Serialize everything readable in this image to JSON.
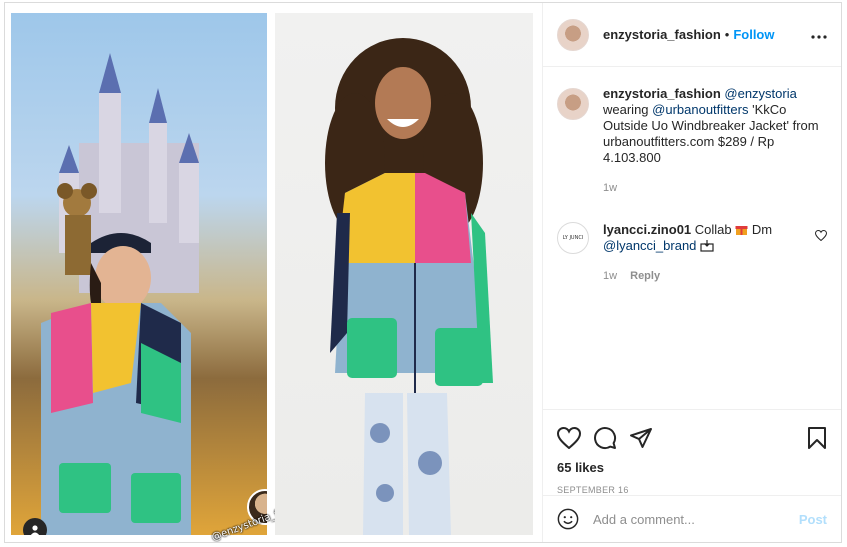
{
  "post": {
    "username": "enzystoria_fashion",
    "follow_label": "Follow",
    "more_label": "•••",
    "watermark": "@enzystoria_fashion"
  },
  "caption": {
    "username": "enzystoria_fashion",
    "mention_1": "@enzystoria",
    "text_1": "wearing",
    "mention_2": "@urbanoutfitters",
    "text_2": "'KkCo Outside Uo Windbreaker Jacket' from urbanoutfitters.com $289 / Rp 4.103.800",
    "time": "1w"
  },
  "comment": {
    "username": "lyancci.zino01",
    "text_1": "Collab",
    "text_2": "Dm",
    "mention": "@lyancci_brand",
    "time": "1w",
    "reply_label": "Reply",
    "brand_avatar_text": "LY JUNCI"
  },
  "stats": {
    "likes": "65 likes",
    "date": "SEPTEMBER 16"
  },
  "add_comment": {
    "placeholder": "Add a comment...",
    "post_label": "Post"
  },
  "colors": {
    "link": "#00376b",
    "follow": "#0095f6",
    "post_disabled": "#b2dffc",
    "jacket_yellow": "#f2c230",
    "jacket_pink": "#e84f8c",
    "jacket_blue": "#8fb3cf",
    "jacket_green": "#2fc283",
    "jacket_navy": "#1f2a4a"
  },
  "icons": [
    "user-tag-icon",
    "more-icon",
    "heart-icon",
    "comment-icon",
    "share-icon",
    "bookmark-icon",
    "emoji-icon",
    "gift-emoji-icon",
    "inbox-emoji-icon"
  ]
}
